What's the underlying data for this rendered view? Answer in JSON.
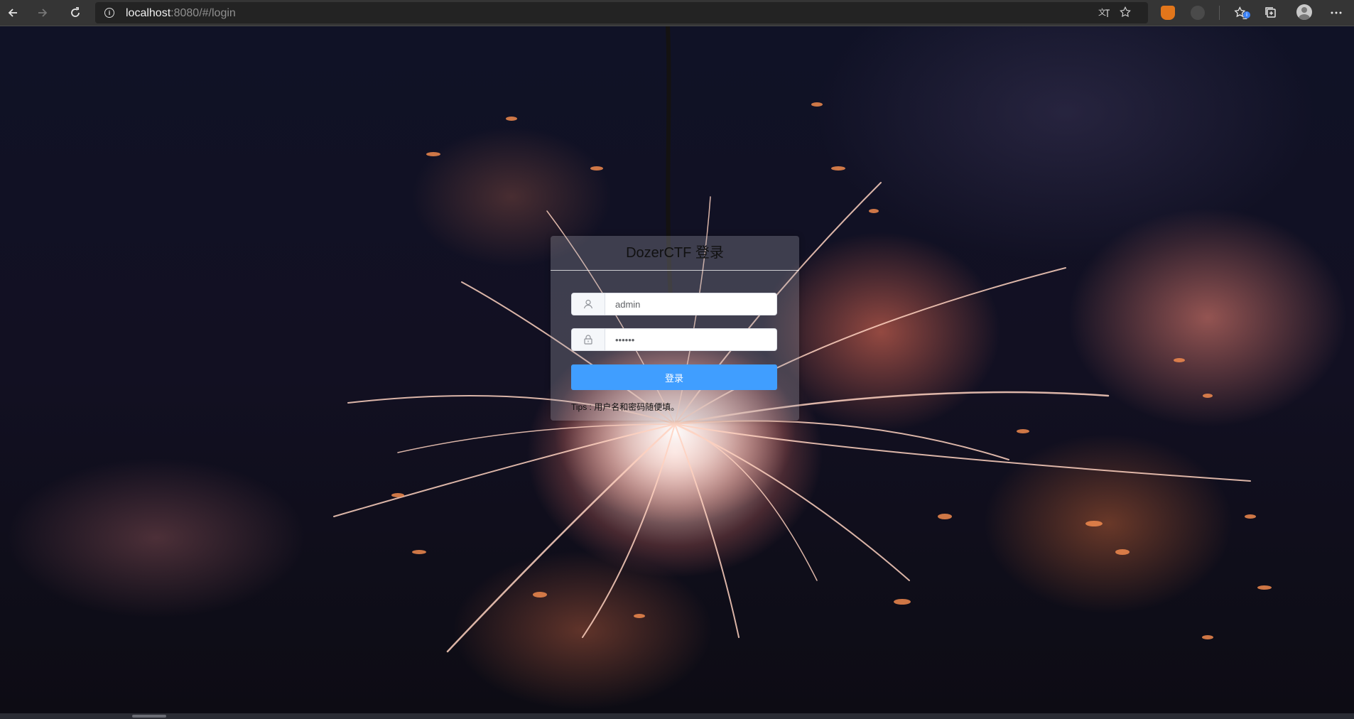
{
  "browser": {
    "url_host": "localhost",
    "url_rest": ":8080/#/login"
  },
  "login": {
    "title": "DozerCTF 登录",
    "username": {
      "value": "admin"
    },
    "password": {
      "value": "••••••"
    },
    "submit_label": "登录",
    "tips": "Tips : 用户名和密码随便填。",
    "colors": {
      "button": "#409eff"
    }
  },
  "icons": {
    "back": "arrow-left-icon",
    "forward": "arrow-right-icon",
    "refresh": "refresh-icon",
    "info": "info-icon",
    "translate": "translate-icon",
    "favorite": "star-icon",
    "extension": "metamask-fox-icon",
    "favorites": "favorites-icon",
    "collections": "collections-icon",
    "profile": "profile-avatar-icon",
    "menu": "more-menu-icon",
    "user": "user-icon",
    "lock": "lock-icon"
  }
}
